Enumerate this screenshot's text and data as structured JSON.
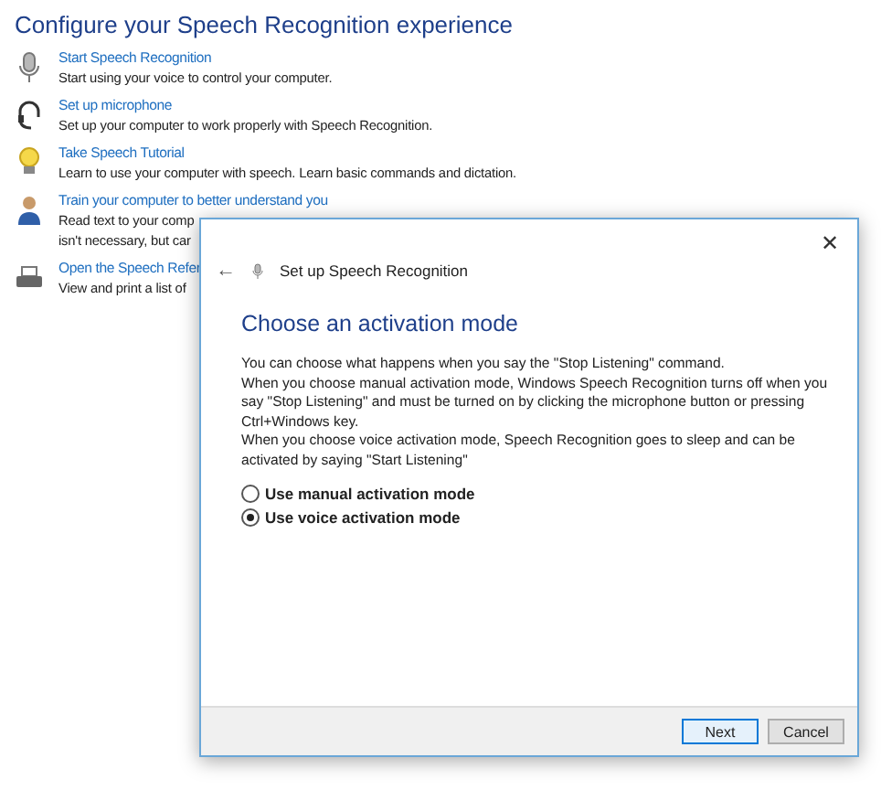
{
  "heading": "Configure your Speech Recognition experience",
  "items": [
    {
      "kind": "mic",
      "link": "Start Speech Recognition",
      "lines": [
        "Start using your voice to control your computer."
      ]
    },
    {
      "kind": "headset",
      "link": "Set up microphone",
      "lines": [
        "Set up your computer to work properly with Speech Recognition."
      ]
    },
    {
      "kind": "bulb",
      "link": "Take Speech Tutorial",
      "lines": [
        "Learn to use your computer with speech.  Learn basic commands and dictation."
      ]
    },
    {
      "kind": "person",
      "link": "Train your computer to better understand you",
      "lines": [
        "Read text to your comp",
        "isn't necessary, but car"
      ]
    },
    {
      "kind": "printer",
      "link": "Open the Speech Refer",
      "lines": [
        "View and print a list of"
      ]
    }
  ],
  "dialog": {
    "close": "✕",
    "back": "←",
    "title": "Set up Speech Recognition",
    "heading": "Choose an activation mode",
    "paragraphs": [
      "You can choose what happens when you say the \"Stop Listening\" command.",
      "When you choose manual activation mode, Windows Speech Recognition turns off when you say \"Stop Listening\" and must be turned on by clicking the microphone button or pressing Ctrl+Windows key.",
      "When you choose voice activation mode, Speech Recognition goes to sleep and can be activated by saying \"Start Listening\""
    ],
    "options": [
      {
        "label": "Use manual activation mode",
        "selected": false
      },
      {
        "label": "Use voice activation mode",
        "selected": true
      }
    ],
    "buttons": [
      {
        "label": "Next",
        "focused": true
      },
      {
        "label": "Cancel",
        "focused": false
      }
    ]
  }
}
